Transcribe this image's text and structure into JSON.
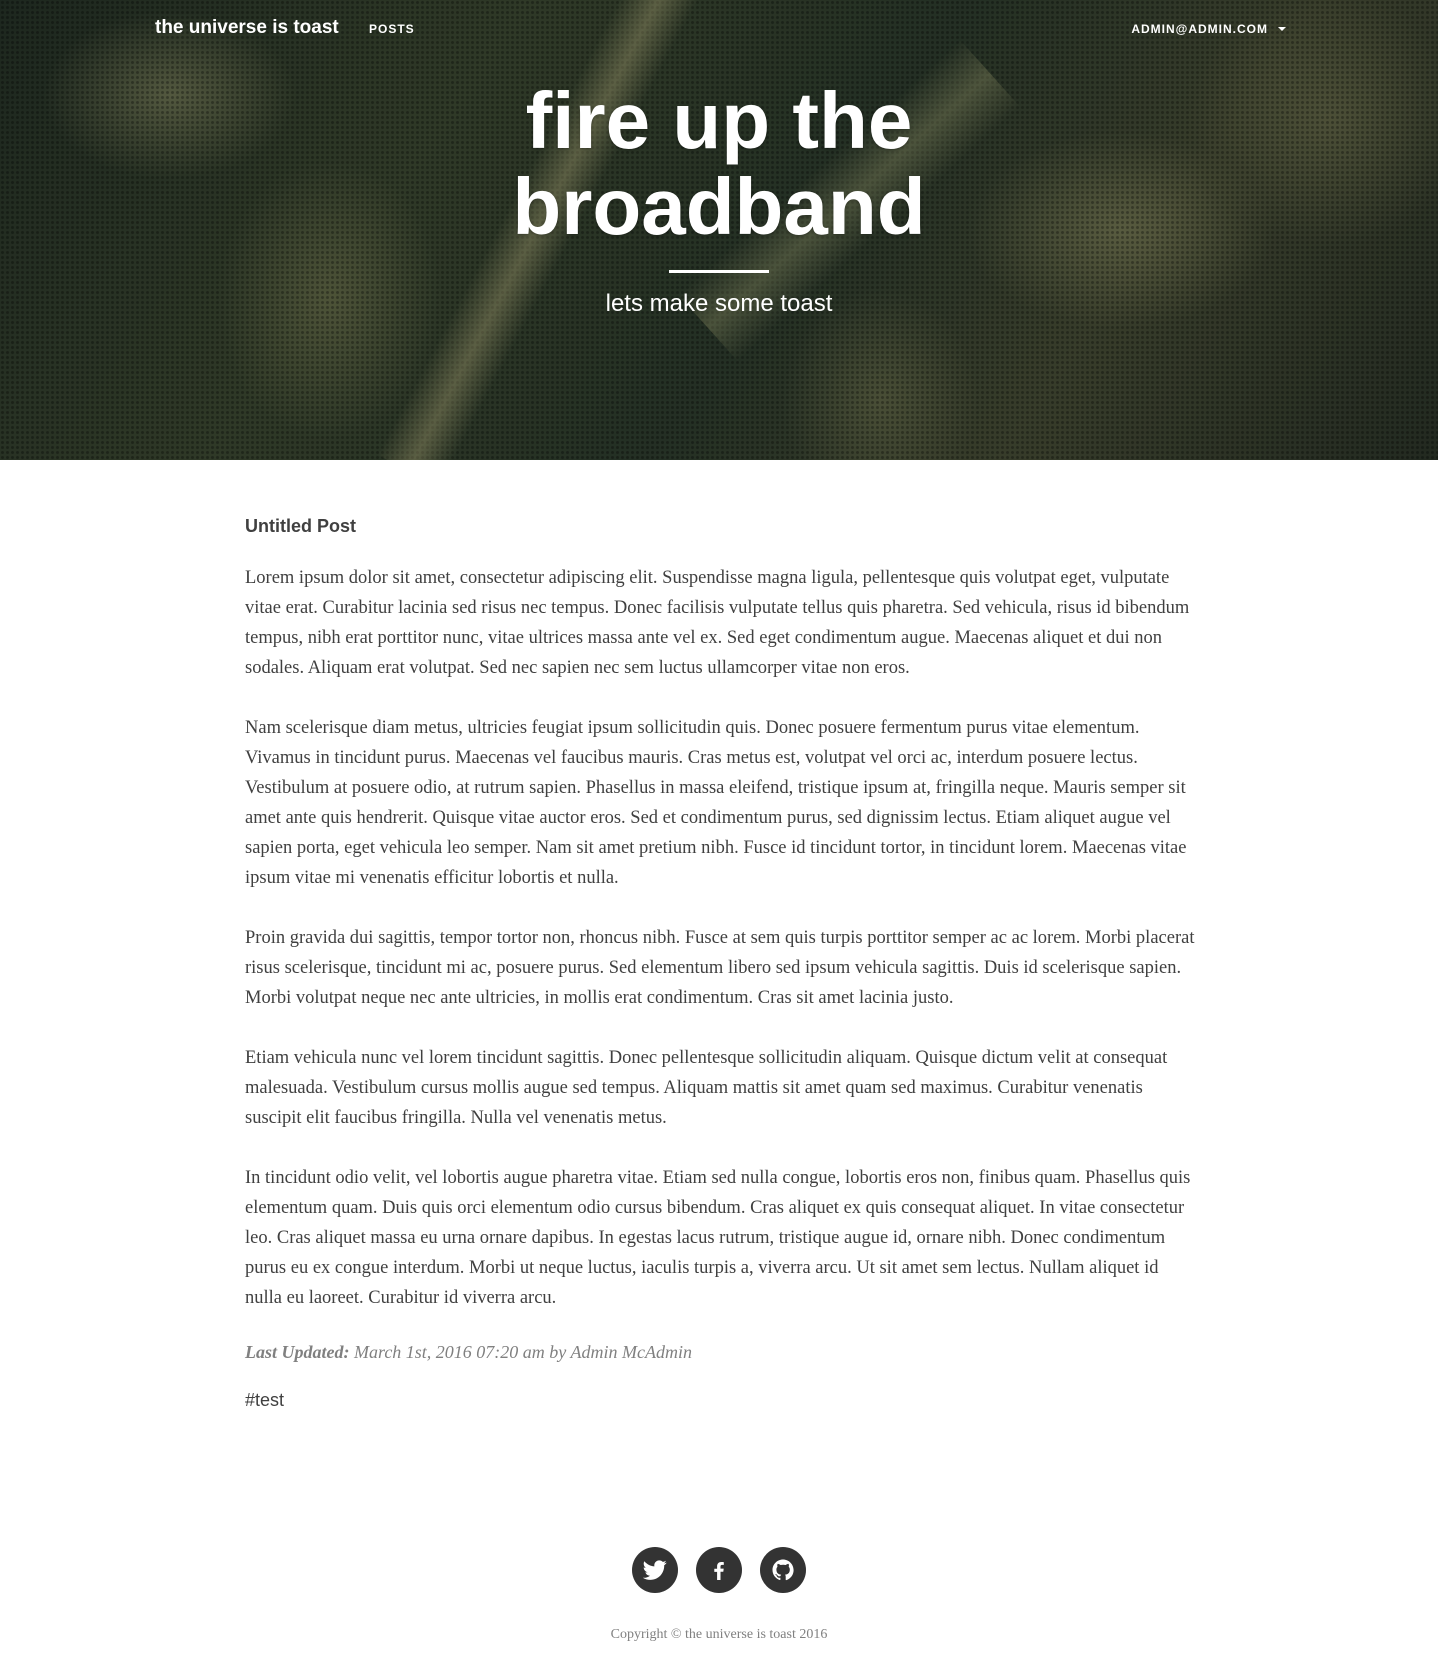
{
  "nav": {
    "brand": "the universe is toast",
    "posts_label": "POSTS",
    "user_label": "ADMIN@ADMIN.COM"
  },
  "hero": {
    "title": "fire up the broadband",
    "subtitle": "lets make some toast"
  },
  "post": {
    "title": "Untitled Post",
    "paragraphs": [
      "Lorem ipsum dolor sit amet, consectetur adipiscing elit. Suspendisse magna ligula, pellentesque quis volutpat eget, vulputate vitae erat. Curabitur lacinia sed risus nec tempus. Donec facilisis vulputate tellus quis pharetra. Sed vehicula, risus id bibendum tempus, nibh erat porttitor nunc, vitae ultrices massa ante vel ex. Sed eget condimentum augue. Maecenas aliquet et dui non sodales. Aliquam erat volutpat. Sed nec sapien nec sem luctus ullamcorper vitae non eros.",
      "Nam scelerisque diam metus, ultricies feugiat ipsum sollicitudin quis. Donec posuere fermentum purus vitae elementum. Vivamus in tincidunt purus. Maecenas vel faucibus mauris. Cras metus est, volutpat vel orci ac, interdum posuere lectus. Vestibulum at posuere odio, at rutrum sapien. Phasellus in massa eleifend, tristique ipsum at, fringilla neque. Mauris semper sit amet ante quis hendrerit. Quisque vitae auctor eros. Sed et condimentum purus, sed dignissim lectus. Etiam aliquet augue vel sapien porta, eget vehicula leo semper. Nam sit amet pretium nibh. Fusce id tincidunt tortor, in tincidunt lorem. Maecenas vitae ipsum vitae mi venenatis efficitur lobortis et nulla.",
      "Proin gravida dui sagittis, tempor tortor non, rhoncus nibh. Fusce at sem quis turpis porttitor semper ac ac lorem. Morbi placerat risus scelerisque, tincidunt mi ac, posuere purus. Sed elementum libero sed ipsum vehicula sagittis. Duis id scelerisque sapien. Morbi volutpat neque nec ante ultricies, in mollis erat condimentum. Cras sit amet lacinia justo.",
      "Etiam vehicula nunc vel lorem tincidunt sagittis. Donec pellentesque sollicitudin aliquam. Quisque dictum velit at consequat malesuada. Vestibulum cursus mollis augue sed tempus. Aliquam mattis sit amet quam sed maximus. Curabitur venenatis suscipit elit faucibus fringilla. Nulla vel venenatis metus.",
      "In tincidunt odio velit, vel lobortis augue pharetra vitae. Etiam sed nulla congue, lobortis eros non, finibus quam. Phasellus quis elementum quam. Duis quis orci elementum odio cursus bibendum. Cras aliquet ex quis consequat aliquet. In vitae consectetur leo. Cras aliquet massa eu urna ornare dapibus. In egestas lacus rutrum, tristique augue id, ornare nibh. Donec condimentum purus eu ex congue interdum. Morbi ut neque luctus, iaculis turpis a, viverra arcu. Ut sit amet sem lectus. Nullam aliquet id nulla eu laoreet. Curabitur id viverra arcu."
    ],
    "meta_label": "Last Updated:",
    "meta_value": "March 1st, 2016 07:20 am by Admin McAdmin",
    "tag": "#test"
  },
  "footer": {
    "social": [
      {
        "name": "twitter",
        "icon": "twitter-icon"
      },
      {
        "name": "facebook",
        "icon": "facebook-icon"
      },
      {
        "name": "github",
        "icon": "github-icon"
      }
    ],
    "copyright": "Copyright © the universe is toast 2016"
  },
  "colors": {
    "body_text": "#404040",
    "muted_text": "#808080",
    "social_bg": "#333333",
    "nav_text": "#ffffff"
  }
}
